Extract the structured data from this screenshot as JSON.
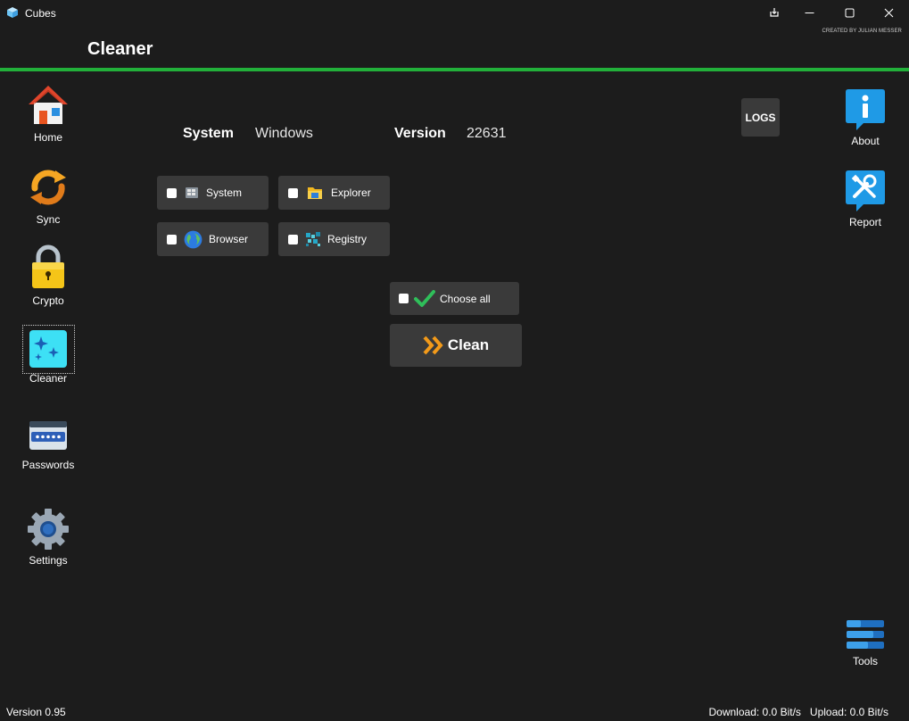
{
  "window": {
    "title": "Cubes",
    "credit": "CREATED BY JULIAN MESSER"
  },
  "page": {
    "title": "Cleaner"
  },
  "left_nav": {
    "home": "Home",
    "sync": "Sync",
    "crypto": "Crypto",
    "cleaner": "Cleaner",
    "passwords": "Passwords",
    "settings": "Settings",
    "active": "cleaner"
  },
  "right_nav": {
    "about": "About",
    "report": "Report",
    "tools": "Tools",
    "logs": "LOGS"
  },
  "system_info": {
    "system_label": "System",
    "system_value": "Windows",
    "version_label": "Version",
    "version_value": "22631"
  },
  "options": {
    "system": "System",
    "explorer": "Explorer",
    "browser": "Browser",
    "registry": "Registry"
  },
  "choose_all": "Choose all",
  "clean_button": "Clean",
  "status": {
    "app_version": "Version 0.95",
    "download_label": "Download:",
    "download_value": "0.0 Bit/s",
    "upload_label": "Upload:",
    "upload_value": "0.0 Bit/s"
  },
  "colors": {
    "accent_line": "#22b03a",
    "background": "#1c1c1c",
    "button_bg": "#3a3a3a"
  }
}
